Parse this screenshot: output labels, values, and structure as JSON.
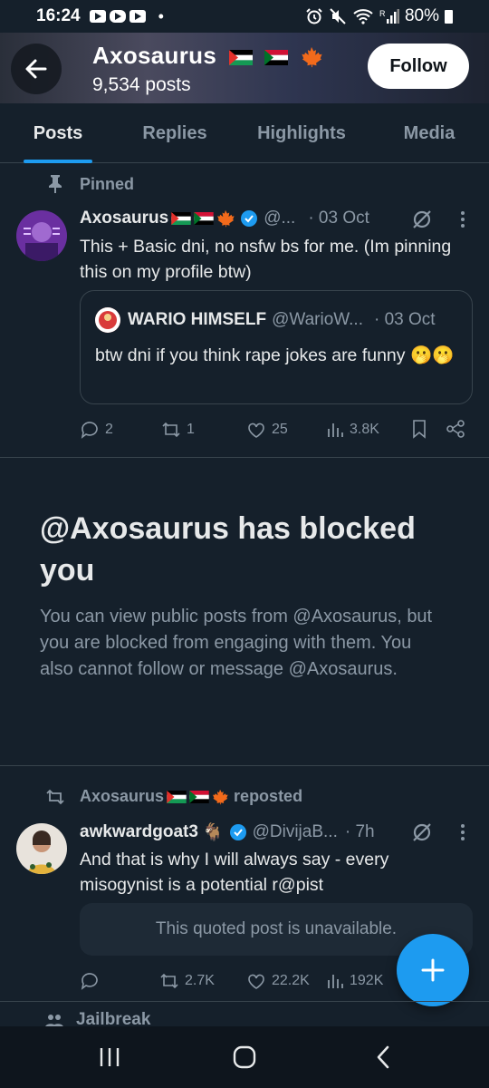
{
  "status_bar": {
    "time": "16:24",
    "dot": "•",
    "battery": "80%",
    "signal_label": "R"
  },
  "header": {
    "name": "Axosaurus",
    "post_count": "9,534 posts",
    "follow_label": "Follow"
  },
  "tabs": [
    {
      "label": "Posts",
      "active": true
    },
    {
      "label": "Replies",
      "active": false
    },
    {
      "label": "Highlights",
      "active": false
    },
    {
      "label": "Media",
      "active": false
    }
  ],
  "pinned_post": {
    "pinned_label": "Pinned",
    "name": "Axosaurus",
    "handle": "@...",
    "date": "· 03 Oct",
    "text": "This + Basic dni, no nsfw bs for me. (Im pinning this on my profile btw)",
    "quote": {
      "name": "WARIO HIMSELF",
      "handle": "@WarioW...",
      "date": "· 03 Oct",
      "text": "btw dni if you think rape jokes are funny 🫢🫢"
    },
    "stats": {
      "replies": "2",
      "reposts": "1",
      "likes": "25",
      "views": "3.8K"
    }
  },
  "blocked": {
    "title": "@Axosaurus has blocked you",
    "description": "You can view public posts from @Axosaurus, but you are blocked from engaging with them. You also cannot follow or message @Axosaurus."
  },
  "repost": {
    "reposter": "Axosaurus",
    "reposted_label": "reposted",
    "name": "awkwardgoat3",
    "emoji": "🐐",
    "handle": "@DivijaB...",
    "date": "· 7h",
    "text": "And that is why I will always say - every misogynist is a potential r@pist",
    "unavailable": "This quoted post is unavailable.",
    "stats": {
      "replies": "",
      "reposts": "2.7K",
      "likes": "22.2K",
      "views": "192K"
    }
  },
  "next_item": {
    "label": "Jailbreak"
  },
  "colors": {
    "background": "#15202b",
    "accent": "#1d9bf0",
    "muted": "#8b98a5",
    "text": "#e7e9ea",
    "border": "#38444d"
  }
}
